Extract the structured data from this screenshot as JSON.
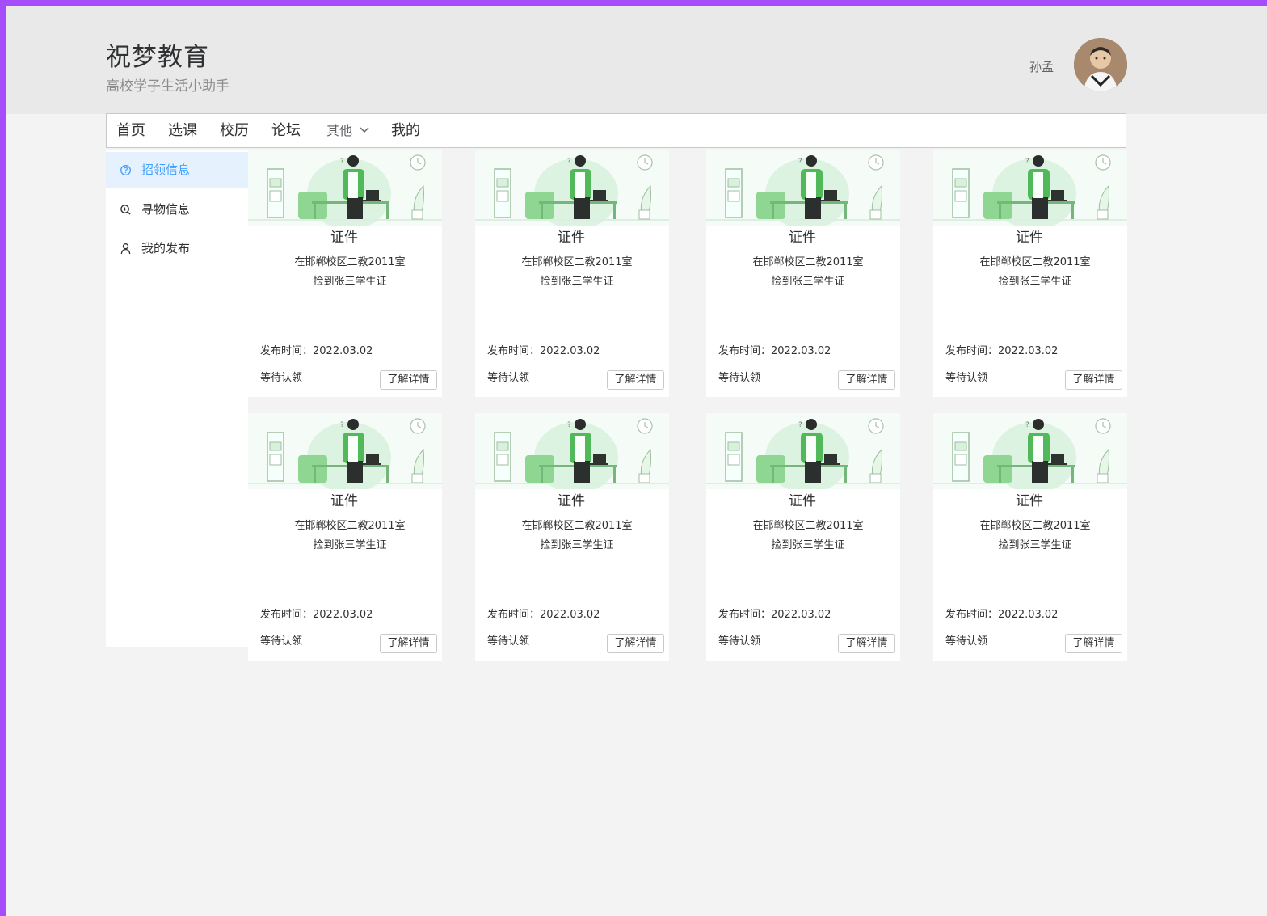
{
  "header": {
    "title": "祝梦教育",
    "subtitle": "高校学子生活小助手",
    "username": "孙孟",
    "avatar_icon": "user-avatar"
  },
  "nav": {
    "items": [
      {
        "label": "首页"
      },
      {
        "label": "选课"
      },
      {
        "label": "校历"
      },
      {
        "label": "论坛"
      },
      {
        "label": "其他",
        "icon": "chevron-down-icon"
      },
      {
        "label": "我的"
      }
    ]
  },
  "sidebar": {
    "items": [
      {
        "label": "招领信息",
        "icon": "question-circle-icon",
        "active": true
      },
      {
        "label": "寻物信息",
        "icon": "zoom-in-icon",
        "active": false
      },
      {
        "label": "我的发布",
        "icon": "user-icon",
        "active": false
      }
    ]
  },
  "colors": {
    "accent": "#409eff",
    "illustration_green": "#67c26f",
    "page_border": "#a64dfb"
  },
  "cards": [
    {
      "title": "证件",
      "location": "在邯郸校区二教2011室",
      "description": "捡到张三学生证",
      "time": "发布时间：2022.03.02",
      "status": "等待认领",
      "button": "了解详情"
    },
    {
      "title": "证件",
      "location": "在邯郸校区二教2011室",
      "description": "捡到张三学生证",
      "time": "发布时间：2022.03.02",
      "status": "等待认领",
      "button": "了解详情"
    },
    {
      "title": "证件",
      "location": "在邯郸校区二教2011室",
      "description": "捡到张三学生证",
      "time": "发布时间：2022.03.02",
      "status": "等待认领",
      "button": "了解详情"
    },
    {
      "title": "证件",
      "location": "在邯郸校区二教2011室",
      "description": "捡到张三学生证",
      "time": "发布时间：2022.03.02",
      "status": "等待认领",
      "button": "了解详情"
    },
    {
      "title": "证件",
      "location": "在邯郸校区二教2011室",
      "description": "捡到张三学生证",
      "time": "发布时间：2022.03.02",
      "status": "等待认领",
      "button": "了解详情"
    },
    {
      "title": "证件",
      "location": "在邯郸校区二教2011室",
      "description": "捡到张三学生证",
      "time": "发布时间：2022.03.02",
      "status": "等待认领",
      "button": "了解详情"
    },
    {
      "title": "证件",
      "location": "在邯郸校区二教2011室",
      "description": "捡到张三学生证",
      "time": "发布时间：2022.03.02",
      "status": "等待认领",
      "button": "了解详情"
    },
    {
      "title": "证件",
      "location": "在邯郸校区二教2011室",
      "description": "捡到张三学生证",
      "time": "发布时间：2022.03.02",
      "status": "等待认领",
      "button": "了解详情"
    }
  ]
}
